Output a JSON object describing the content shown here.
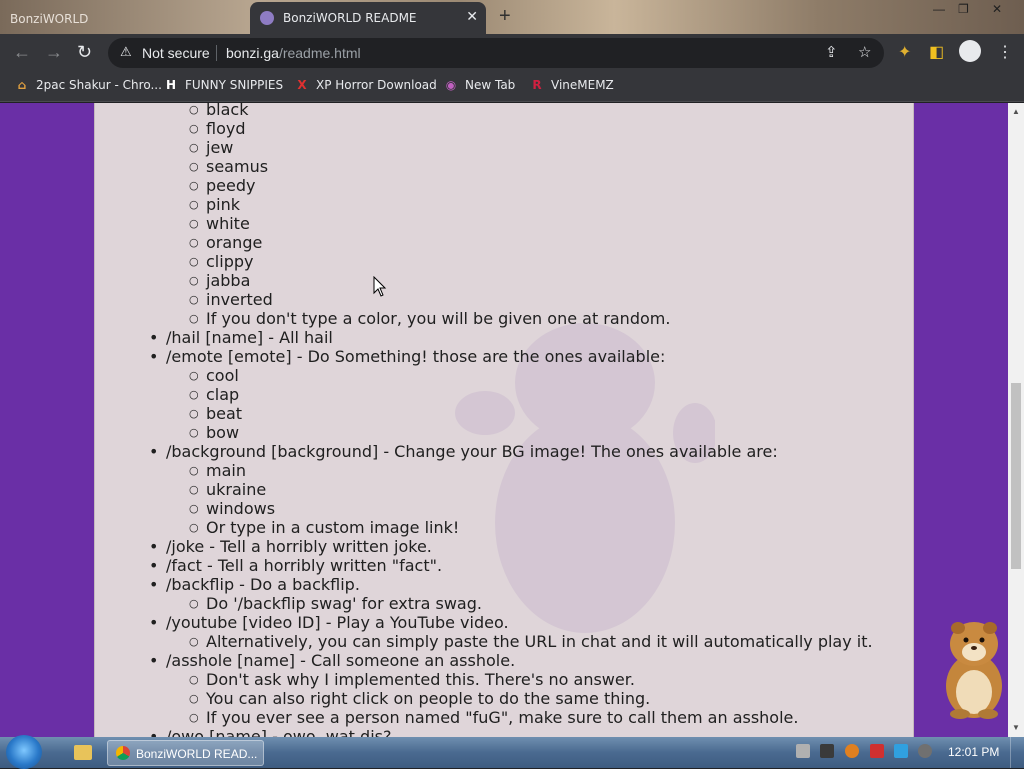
{
  "browser": {
    "tabs": [
      {
        "label": "BonziWORLD"
      },
      {
        "label": "BonziWORLD README",
        "close_glyph": "✕"
      }
    ],
    "new_tab_glyph": "+",
    "window_controls": [
      "—",
      "❐",
      "✕"
    ],
    "toolbar": {
      "back_glyph": "←",
      "forward_glyph": "→",
      "reload_glyph": "↻",
      "warning_glyph": "⚠",
      "security_label": "Not secure",
      "url_host": "bonzi.ga",
      "url_path": "/readme.html",
      "share_glyph": "⇪",
      "star_glyph": "☆",
      "extensions_glyph": "✦",
      "sidepanel_glyph": "◧",
      "menu_glyph": "⋮"
    },
    "bookmarks": [
      {
        "icon": "⌂",
        "label": "2pac Shakur - Chro...",
        "color": "#e0a040"
      },
      {
        "icon": "H",
        "label": "FUNNY SNIPPIES",
        "color": "#ffffff"
      },
      {
        "icon": "X",
        "label": "XP Horror Download",
        "color": "#e03030"
      },
      {
        "icon": "◉",
        "label": "New Tab",
        "color": "#c060c0"
      },
      {
        "icon": "R",
        "label": "VineMEMZ",
        "color": "#d02040"
      }
    ]
  },
  "readme": {
    "colors": [
      "black",
      "floyd",
      "jew",
      "seamus",
      "peedy",
      "pink",
      "white",
      "orange",
      "clippy",
      "jabba",
      "inverted",
      "If you don't type a color, you will be given one at random."
    ],
    "hail": "/hail [name] - All hail",
    "emote": "/emote [emote] - Do Something! those are the ones available:",
    "emotes": [
      "cool",
      "clap",
      "beat",
      "bow"
    ],
    "background": "/background [background] - Change your BG image! The ones available are:",
    "backgrounds": [
      "main",
      "ukraine",
      "windows",
      "Or type in a custom image link!"
    ],
    "joke": "/joke - Tell a horribly written joke.",
    "fact": "/fact - Tell a horribly written \"fact\".",
    "backflip": "/backflip - Do a backflip.",
    "backflip_note": "Do '/backflip swag' for extra swag.",
    "youtube": "/youtube [video ID] - Play a YouTube video.",
    "youtube_note": "Alternatively, you can simply paste the URL in chat and it will automatically play it.",
    "asshole": "/asshole [name] - Call someone an asshole.",
    "asshole_notes": [
      "Don't ask why I implemented this. There's no answer.",
      "You can also right click on people to do the same thing.",
      "If you ever see a person named \"fuG\", make sure to call them an asshole."
    ],
    "owo": "/owo [name] - owo, wat dis?"
  },
  "scrollbar": {
    "up_glyph": "▲",
    "down_glyph": "▼",
    "position": 0.62
  },
  "taskbar": {
    "chrome_label": "BonziWORLD READ...",
    "clock": "12:01 PM"
  },
  "colors": {
    "page_bg": "#6a2fa6",
    "content_bg": "#dfd5d9",
    "chrome_dark": "#35363a"
  }
}
